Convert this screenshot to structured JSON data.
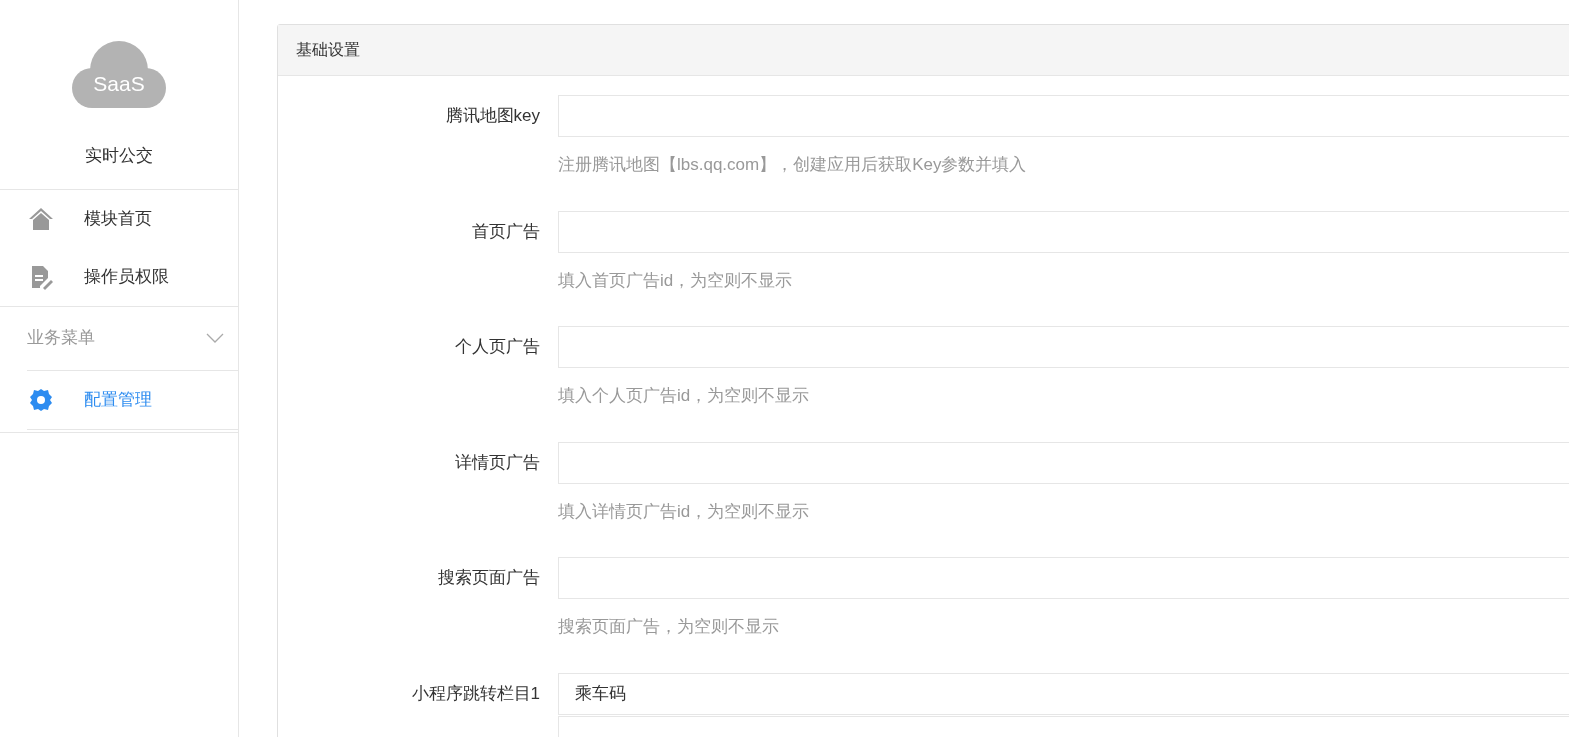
{
  "sidebar": {
    "logo": {
      "text": "SaaS"
    },
    "app_name": "实时公交",
    "items": [
      {
        "label": "模块首页",
        "kind": "home",
        "selected": false
      },
      {
        "label": "操作员权限",
        "kind": "document",
        "selected": false
      }
    ],
    "group": {
      "label": "业务菜单",
      "expanded": true,
      "items": [
        {
          "label": "配置管理",
          "kind": "gear",
          "selected": true
        }
      ]
    }
  },
  "panel": {
    "title": "基础设置",
    "fields": [
      {
        "label": "腾讯地图key",
        "hint": "注册腾讯地图【lbs.qq.com】，创建应用后获取Key参数并填入"
      },
      {
        "label": "首页广告",
        "hint": "填入首页广告id，为空则不显示"
      },
      {
        "label": "个人页广告",
        "hint": "填入个人页广告id，为空则不显示"
      },
      {
        "label": "详情页广告",
        "hint": "填入详情页广告id，为空则不显示"
      },
      {
        "label": "搜索页面广告",
        "hint": "搜索页面广告，为空则不显示"
      },
      {
        "label": "小程序跳转栏目1",
        "value": "乘车码",
        "extra_input": true
      }
    ]
  }
}
